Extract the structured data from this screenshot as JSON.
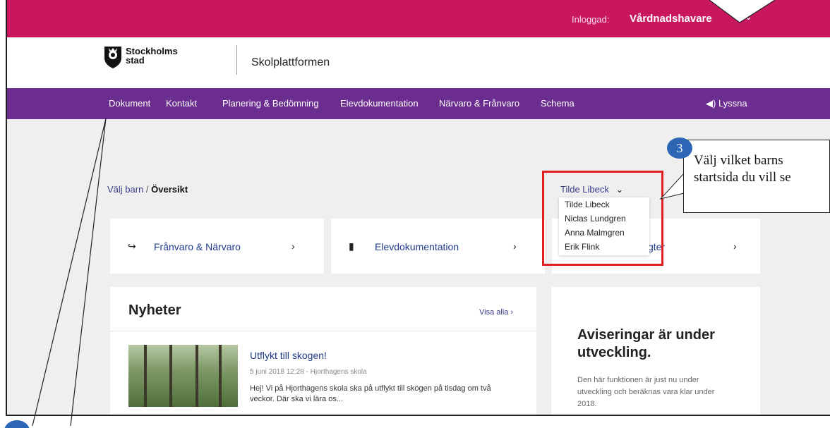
{
  "topbar": {
    "login_label": "Inloggad:",
    "role": "Vårdnadshavare",
    "role_chevron": "⌄"
  },
  "header": {
    "logo_line1": "Stockholms",
    "logo_line2": "stad",
    "platform_name": "Skolplattformen"
  },
  "nav": {
    "items": [
      {
        "label": "Dokument"
      },
      {
        "label": "Kontakt"
      },
      {
        "label": "Planering & Bedömning"
      },
      {
        "label": "Elevdokumentation"
      },
      {
        "label": "Närvaro & Frånvaro"
      },
      {
        "label": "Schema"
      }
    ],
    "listen_label": "◀) Lyssna"
  },
  "breadcrumb": {
    "link": "Välj barn",
    "separator": " / ",
    "current": "Översikt"
  },
  "child_select": {
    "selected": "Tilde Libeck",
    "chevron": "⌄",
    "options": [
      "Tilde Libeck",
      "Niclas Lundgren",
      "Anna Malmgren",
      "Erik Flink"
    ]
  },
  "tiles": [
    {
      "icon": "↪",
      "label": "Frånvaro & Närvaro",
      "chevron": "›"
    },
    {
      "icon": "▮",
      "label": "Elevdokumentation",
      "chevron": "›"
    },
    {
      "label": "gter",
      "chevron": "›"
    }
  ],
  "news": {
    "title": "Nyheter",
    "see_all": "Visa alla ›",
    "headline": "Utflykt till skogen!",
    "meta": "5 juni 2018 12:28 - Hjorthagens skola",
    "body": "Hej! Vi på Hjorthagens skola ska på utflykt till skogen på tisdag om två veckor. Där ska vi lära os..."
  },
  "alerts": {
    "title": "Aviseringar är under utveckling.",
    "body": "Den här funktionen är just nu under utveckling och beräknas vara klar under 2018."
  },
  "callout": {
    "number": "3",
    "text": "Välj vilket barns startsida du vill se"
  },
  "colors": {
    "topbar": "#c8175f",
    "nav": "#6b2d8f",
    "highlight": "#e02020",
    "badge": "#2d66b5"
  }
}
